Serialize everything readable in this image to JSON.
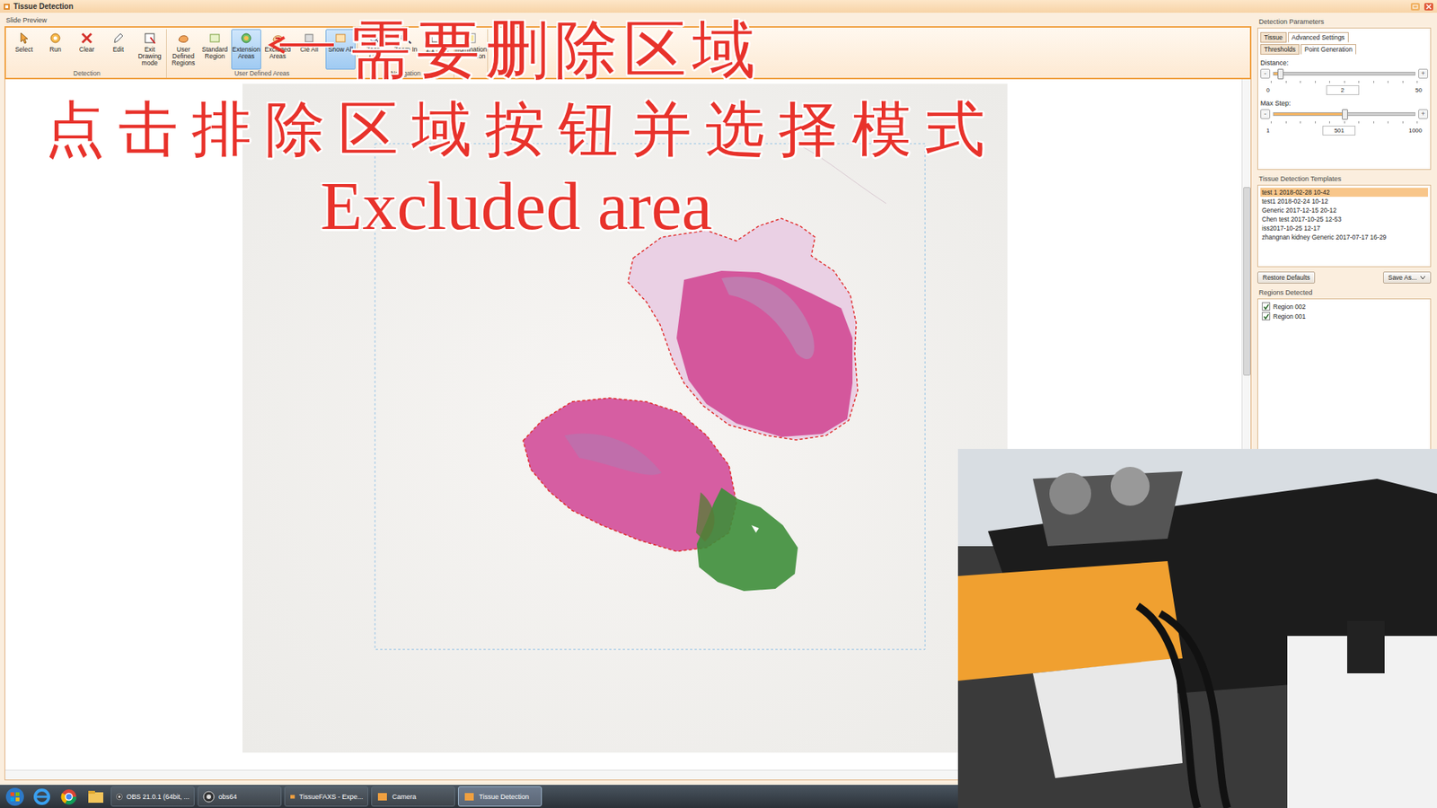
{
  "window": {
    "title": "Tissue Detection"
  },
  "slide_preview": {
    "label": "Slide Preview"
  },
  "ribbon": {
    "groups": [
      {
        "label": "Detection",
        "buttons": [
          {
            "label": "Select",
            "selected": false
          },
          {
            "label": "Run",
            "selected": false
          },
          {
            "label": "Clear",
            "selected": false
          },
          {
            "label": "Edit",
            "selected": false
          },
          {
            "label": "Exit Drawing mode",
            "selected": false
          }
        ]
      },
      {
        "label": "User Defined Areas",
        "buttons": [
          {
            "label": "User Defined Regions",
            "selected": false
          },
          {
            "label": "Standard Region",
            "selected": false
          },
          {
            "label": "Extension Areas",
            "selected": true
          },
          {
            "label": "Excluded Areas",
            "selected": false
          },
          {
            "label": "Cle All",
            "selected": false
          },
          {
            "label": "Show All",
            "selected": true
          }
        ]
      },
      {
        "label": "Navigation",
        "buttons": [
          {
            "label": "Zoom Out",
            "selected": false
          },
          {
            "label": "Zoom In",
            "selected": false
          },
          {
            "label": "1:1 Size",
            "selected": false
          }
        ]
      },
      {
        "buttons": [
          {
            "label": "Illumination Correction",
            "selected": false
          }
        ]
      }
    ]
  },
  "annotations": [
    {
      "text": "需要删除区域"
    },
    {
      "text": "点击排除区域按钮并选择模式"
    },
    {
      "text": "Excluded area"
    }
  ],
  "detection_parameters": {
    "title": "Detection Parameters",
    "tabs": [
      {
        "label": "Tissue",
        "selected": false
      },
      {
        "label": "Advanced Settings",
        "selected": true
      }
    ],
    "subtabs": [
      {
        "label": "Thresholds",
        "selected": false
      },
      {
        "label": "Point Generation",
        "selected": true
      }
    ],
    "sliders": [
      {
        "label": "Distance:",
        "minus": "-",
        "plus": "+",
        "min": "0",
        "max": "50",
        "value": "2",
        "level": 0.04
      },
      {
        "label": "Max Step:",
        "minus": "-",
        "plus": "+",
        "min": "1",
        "max": "1000",
        "value": "501",
        "level": 0.5
      }
    ]
  },
  "templates": {
    "title": "Tissue Detection Templates",
    "items": [
      {
        "label": "test 1 2018-02-28 10-42",
        "selected": true
      },
      {
        "label": "test1 2018-02-24 10-12",
        "selected": false
      },
      {
        "label": "Generic 2017-12-15 20-12",
        "selected": false
      },
      {
        "label": "Chen test 2017-10-25 12-53",
        "selected": false
      },
      {
        "label": "iss2017-10-25 12-17",
        "selected": false
      },
      {
        "label": "zhangnan kidney Generic 2017-07-17 16-29",
        "selected": false
      }
    ]
  },
  "template_buttons": [
    {
      "label": "Restore Defaults"
    },
    {
      "label": "Save As..."
    }
  ],
  "regions": {
    "title": "Regions Detected",
    "items": [
      {
        "label": "Region 002",
        "checked": true
      },
      {
        "label": "Region 001",
        "checked": true
      }
    ]
  },
  "taskbar": {
    "items": [
      {
        "label": "OBS 21.0.1 (64bit, ...",
        "active": false
      },
      {
        "label": "obs64",
        "active": false
      },
      {
        "label": "TissueFAXS - Expe...",
        "active": false
      },
      {
        "label": "Camera",
        "active": false
      },
      {
        "label": "Tissue Detection",
        "active": true
      }
    ]
  }
}
